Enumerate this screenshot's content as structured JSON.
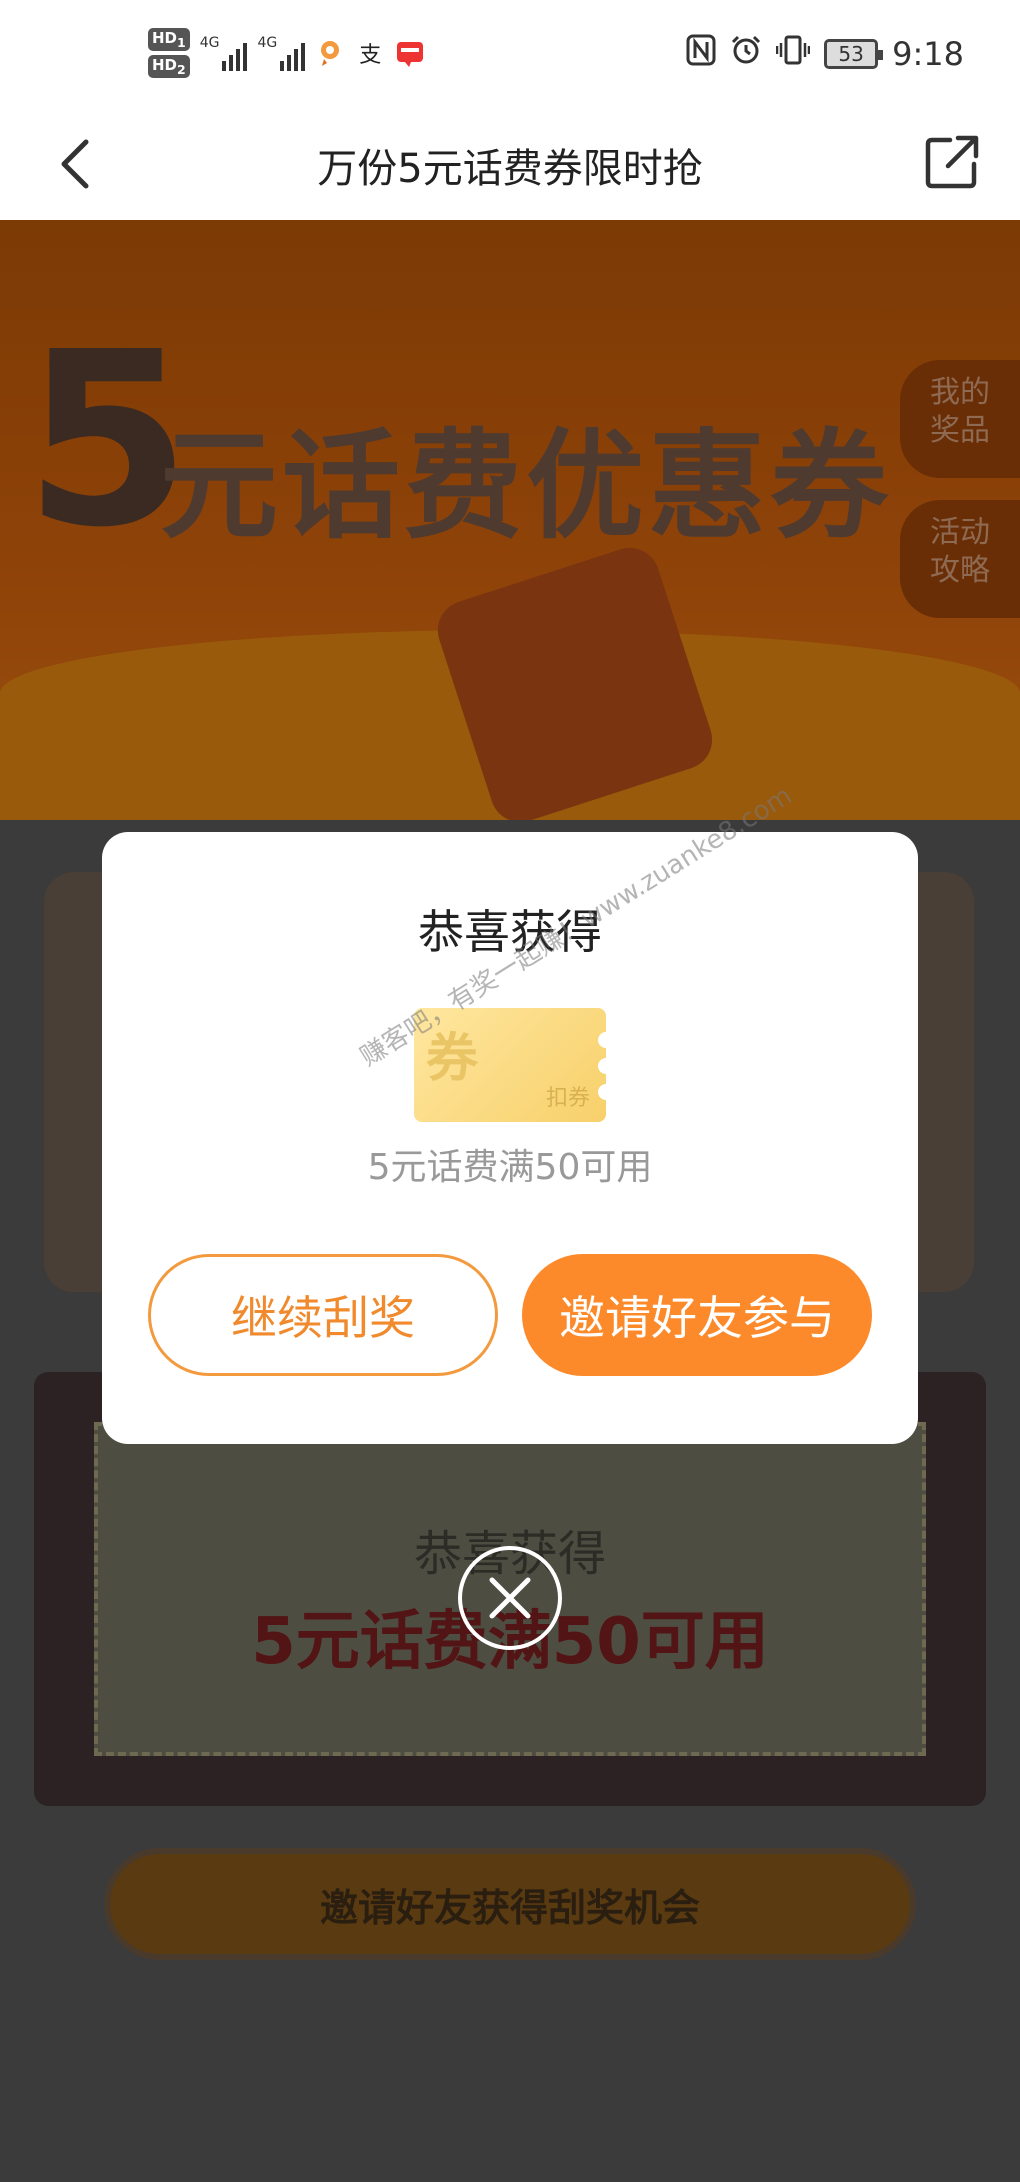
{
  "status_bar": {
    "hd1": "HD",
    "hd1_sub": "1",
    "hd2": "HD",
    "hd2_sub": "2",
    "net1": "4G",
    "net2": "4G",
    "app_icons": [
      "location-pin-icon",
      "alipay-icon",
      "app-badge-icon"
    ],
    "alipay_glyph": "支",
    "right_icons": [
      "nfc-icon",
      "alarm-icon",
      "vibrate-icon"
    ],
    "battery": "53",
    "time": "9:18"
  },
  "title_bar": {
    "title": "万份5元话费券限时抢"
  },
  "banner": {
    "big_number": "5",
    "title": "元话费优惠券",
    "side_tabs": [
      "我的\n奖品",
      "活动\n攻略"
    ]
  },
  "ticket": {
    "congrats": "恭喜获得",
    "prize": "5元话费满50可用"
  },
  "invite_bar": {
    "label": "邀请好友获得刮奖机会"
  },
  "modal": {
    "title": "恭喜获得",
    "coupon_glyph": "券",
    "coupon_small": "扣券",
    "watermark": "赚客吧，有奖一起赚！www.zuanke8.com",
    "coupon_desc": "5元话费满50可用",
    "continue_label": "继续刮奖",
    "invite_label": "邀请好友参与"
  },
  "colors": {
    "accent": "#fd8a2a",
    "accent_text": "#f08a2d"
  }
}
